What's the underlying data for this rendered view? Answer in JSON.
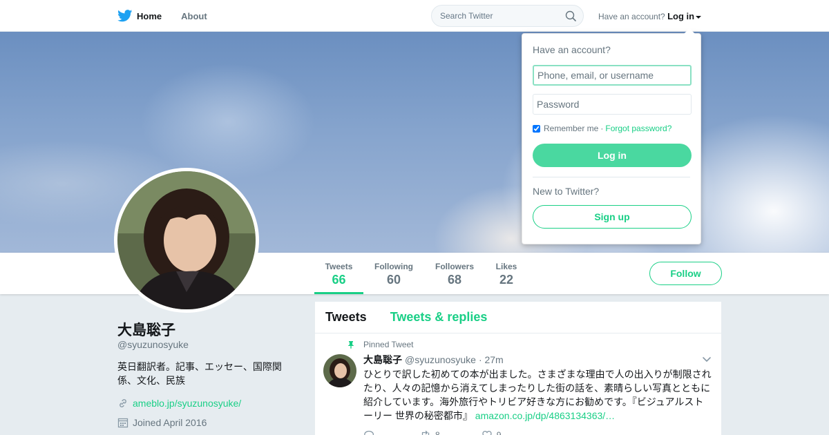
{
  "nav": {
    "home": "Home",
    "about": "About",
    "search_placeholder": "Search Twitter",
    "have_account": "Have an account?",
    "login": "Log in"
  },
  "login_dropdown": {
    "title": "Have an account?",
    "username_placeholder": "Phone, email, or username",
    "password_placeholder": "Password",
    "remember_me": "Remember me",
    "separator": "·",
    "forgot_password": "Forgot password?",
    "login_button": "Log in",
    "new_to": "New to Twitter?",
    "signup_button": "Sign up"
  },
  "stats": [
    {
      "label": "Tweets",
      "value": "66"
    },
    {
      "label": "Following",
      "value": "60"
    },
    {
      "label": "Followers",
      "value": "68"
    },
    {
      "label": "Likes",
      "value": "22"
    }
  ],
  "follow_button": "Follow",
  "profile": {
    "name": "大島聡子",
    "handle": "@syuzunosyuke",
    "bio": "英日翻訳者。記事、エッセー、国際関係、文化、民族",
    "link": "ameblo.jp/syuzunosyuke/",
    "joined": "Joined April 2016"
  },
  "timeline": {
    "tabs": [
      "Tweets",
      "Tweets & replies"
    ],
    "pinned_label": "Pinned Tweet",
    "tweet": {
      "name": "大島聡子",
      "handle": "@syuzunosyuke",
      "time": "· 27m",
      "text": "ひとりで訳した初めての本が出ました。さまざまな理由で人の出入りが制限されたり、人々の記憶から消えてしまったりした街の話を、素晴らしい写真とともに紹介しています。海外旅行やトリビア好きな方にお勧めです。『ビジュアルストーリー 世界の秘密都市』",
      "link": "amazon.co.jp/dp/4863134363/…",
      "retweets": "8",
      "likes": "9"
    }
  },
  "colors": {
    "accent": "#19cf86",
    "login_button": "#4ad8a0",
    "brand_twitter": "#1da1f2"
  }
}
